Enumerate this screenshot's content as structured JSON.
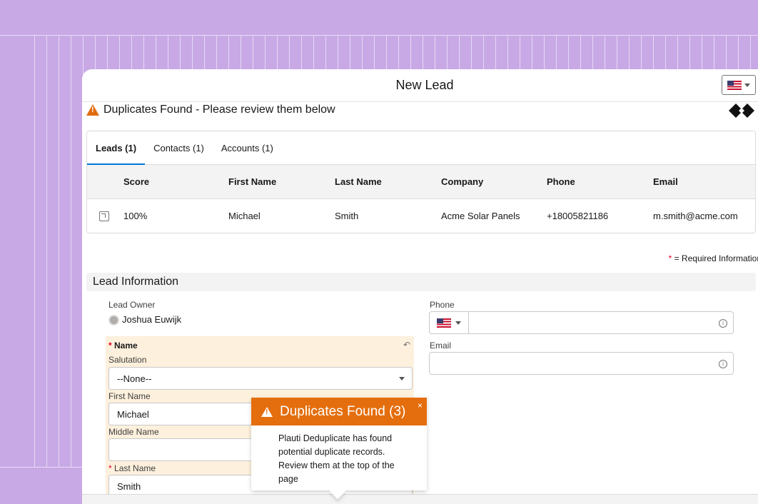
{
  "modal": {
    "title": "New Lead"
  },
  "banner": {
    "text": "Duplicates Found - Please review them below"
  },
  "tabs": [
    {
      "label": "Leads (1)",
      "active": true
    },
    {
      "label": "Contacts (1)",
      "active": false
    },
    {
      "label": "Accounts (1)",
      "active": false
    }
  ],
  "table": {
    "headers": [
      "Score",
      "First Name",
      "Last Name",
      "Company",
      "Phone",
      "Email"
    ],
    "rows": [
      {
        "score": "100%",
        "first_name": "Michael",
        "last_name": "Smith",
        "company": "Acme Solar Panels",
        "phone": "+18005821186",
        "email": "m.smith@acme.com"
      }
    ]
  },
  "required_note": {
    "star": "*",
    "text": " = Required Information"
  },
  "section": {
    "title": "Lead Information"
  },
  "form": {
    "lead_owner_label": "Lead Owner",
    "lead_owner_value": "Joshua Euwijk",
    "name_label": "Name",
    "required_star": "*",
    "salutation_label": "Salutation",
    "salutation_value": "--None--",
    "first_name_label": "First Name",
    "first_name_value": "Michael",
    "middle_name_label": "Middle Name",
    "middle_name_value": "",
    "last_name_label": "Last Name",
    "last_name_value": "Smith",
    "phone_label": "Phone",
    "phone_value": "",
    "email_label": "Email",
    "email_value": ""
  },
  "toast": {
    "title": "Duplicates Found (3)",
    "body": "Plauti Deduplicate has found potential duplicate records. Review them at the top of the page",
    "close": "×"
  },
  "icons": {
    "warning": "warning-icon",
    "flag": "us-flag-icon",
    "info": "info-icon",
    "undo": "undo-icon",
    "open_record": "open-record-icon",
    "owner": "user-avatar-icon",
    "logo": "plauti-logo"
  },
  "colors": {
    "background": "#c8a9e6",
    "warning_orange": "#e46e0d",
    "required_red": "#ea001e",
    "tab_active": "#0176d3",
    "name_highlight": "#fdf0dd"
  }
}
